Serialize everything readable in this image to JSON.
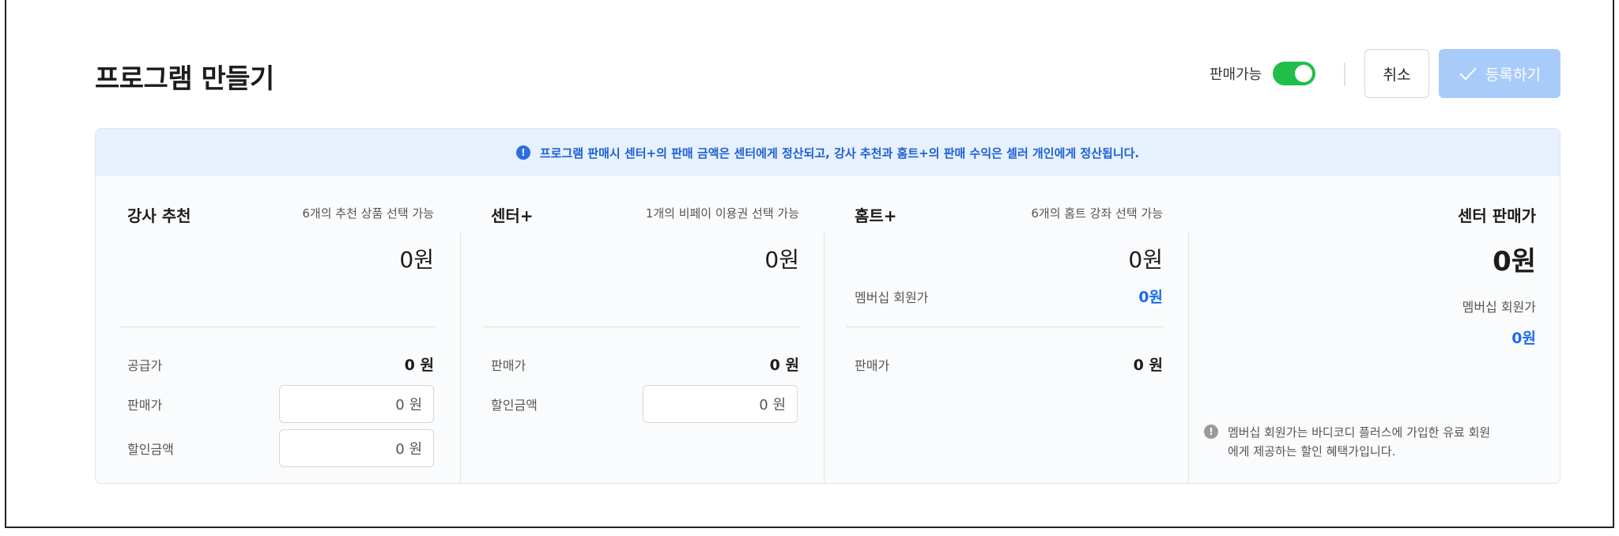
{
  "header": {
    "title": "프로그램 만들기",
    "sale_label": "판매가능",
    "sale_enabled": true,
    "cancel_label": "취소",
    "submit_label": "등록하기"
  },
  "notice": {
    "text": "프로그램 판매시 센터+의 판매 금액은 센터에게 정산되고, 강사 추천과 홈트+의 판매 수익은 셀러 개인에게 정산됩니다."
  },
  "instructor": {
    "title": "강사 추천",
    "hint": "6개의 추천 상품 선택 가능",
    "price": "0원",
    "supply_label": "공급가",
    "supply_value": "0 원",
    "sale_label": "판매가",
    "sale_value": "0 원",
    "discount_label": "할인금액",
    "discount_value": "0 원"
  },
  "center": {
    "title": "센터+",
    "hint": "1개의 비페이 이용권 선택 가능",
    "price": "0원",
    "sale_label": "판매가",
    "sale_value": "0 원",
    "discount_label": "할인금액",
    "discount_value": "0 원"
  },
  "homet": {
    "title": "홈트+",
    "hint": "6개의 홈트 강좌 선택 가능",
    "price": "0원",
    "member_label": "멤버십 회원가",
    "member_value": "0원",
    "sale_label": "판매가",
    "sale_value": "0 원"
  },
  "summary": {
    "title": "센터 판매가",
    "price": "0원",
    "member_label": "멤버십 회원가",
    "member_value": "0원",
    "note_line1": "멤버십 회원가는 바디코디 플러스에 가입한 유료 회원",
    "note_line2": "에게 제공하는 할인 혜택가입니다."
  },
  "colors": {
    "toggle_on": "#1fbf4a",
    "submit_disabled": "#a8cbfa",
    "notice_bg": "#e7f1fd",
    "accent_blue": "#1a6ee6"
  }
}
